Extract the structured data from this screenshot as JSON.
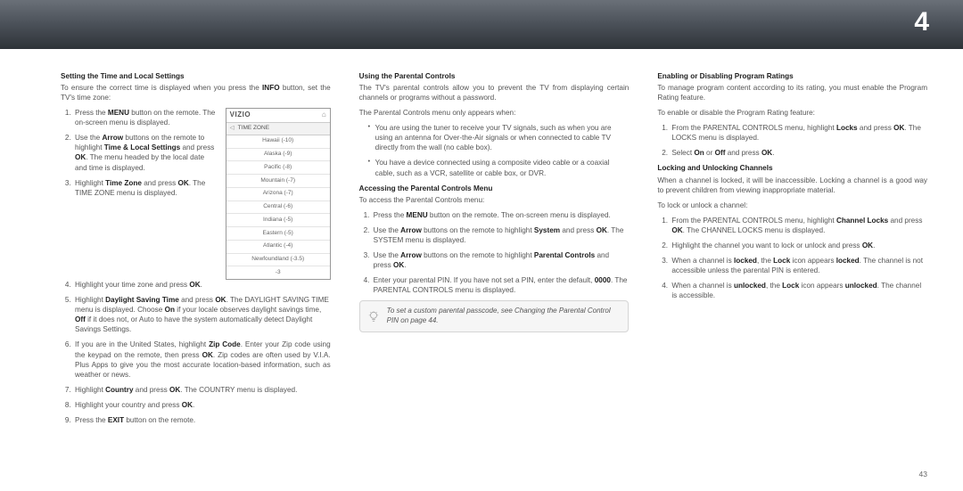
{
  "chapter": "4",
  "page_number": "43",
  "col1": {
    "h1": "Setting the Time and Local Settings",
    "p1a": "To ensure the correct time is displayed when you press the ",
    "p1b": "INFO",
    "p1c": " button, set the TV's time zone:",
    "li1a": "Press the ",
    "li1b": "MENU",
    "li1c": " button on the remote. The on-screen menu is displayed.",
    "li2a": "Use the ",
    "li2b": "Arrow",
    "li2c": " buttons on the remote to highlight ",
    "li2d": "Time & Local Settings",
    "li2e": " and press ",
    "li2f": "OK",
    "li2g": ". The menu headed by the local date and time is displayed.",
    "li3a": "Highlight ",
    "li3b": "Time Zone",
    "li3c": " and press ",
    "li3d": "OK",
    "li3e": ". The TIME ZONE menu is displayed.",
    "li4a": "Highlight your time zone and press ",
    "li4b": "OK",
    "li4c": ".",
    "li5a": "Highlight ",
    "li5b": "Daylight Saving Time",
    "li5c": " and press ",
    "li5d": "OK",
    "li5e": ". The DAYLIGHT SAVING TIME menu is displayed. Choose ",
    "li5f": "On",
    "li5g": " if your locale observes daylight savings time, ",
    "li5h": "Off",
    "li5i": " if it does not, or Auto to have the system automatically detect Daylight Savings Settings.",
    "li6a": "If you are in the United States, highlight ",
    "li6b": "Zip Code",
    "li6c": ". Enter your Zip code using the keypad on the remote, then press ",
    "li6d": "OK",
    "li6e": ". Zip codes are often used by V.I.A. Plus Apps to give you the most accurate location-based information, such as weather or news.",
    "li7a": "Highlight ",
    "li7b": "Country",
    "li7c": " and press ",
    "li7d": "OK",
    "li7e": ". The COUNTRY menu is displayed.",
    "li8a": "Highlight your country and press ",
    "li8b": "OK",
    "li8c": ".",
    "li9a": "Press the ",
    "li9b": "EXIT",
    "li9c": " button on the remote."
  },
  "menu": {
    "brand": "VIZIO",
    "title": "TIME ZONE",
    "rows": [
      "Hawaii (-10)",
      "Alaska (-9)",
      "Pacific (-8)",
      "Mountain (-7)",
      "Arizona (-7)",
      "Central (-6)",
      "Indiana (-5)",
      "Eastern (-5)",
      "Atlantic (-4)",
      "Newfoundland (-3.5)",
      "-3"
    ]
  },
  "col2": {
    "h1": "Using the Parental Controls",
    "p1": "The TV's parental controls allow you to prevent the TV from displaying certain channels or programs without a password.",
    "p2": "The Parental Controls menu only appears when:",
    "b1": "You are using the tuner to receive your TV signals, such as when you are using an antenna for Over-the-Air signals or when connected to cable TV directly from the wall (no cable box).",
    "b2": "You have a device connected using a composite video cable or a coaxial cable, such as a VCR, satellite or cable box, or DVR.",
    "h2": "Accessing the Parental Controls Menu",
    "p3": "To access the Parental Controls menu:",
    "li1a": "Press the ",
    "li1b": "MENU",
    "li1c": " button on the remote. The on-screen menu is displayed.",
    "li2a": "Use the ",
    "li2b": "Arrow",
    "li2c": " buttons on the remote to highlight ",
    "li2d": "System",
    "li2e": " and press ",
    "li2f": "OK",
    "li2g": ". The SYSTEM menu is displayed.",
    "li3a": "Use the ",
    "li3b": "Arrow",
    "li3c": " buttons on the remote to highlight ",
    "li3d": "Parental Controls",
    "li3e": " and press ",
    "li3f": "OK",
    "li3g": ".",
    "li4a": "Enter your parental PIN. If you have not set a PIN, enter the default, ",
    "li4b": "0000",
    "li4c": ". The PARENTAL CONTROLS menu is displayed.",
    "callout_a": "To set a custom parental passcode, see ",
    "callout_b": "Changing the Parental Control PIN",
    "callout_c": " on page 44."
  },
  "col3": {
    "h1": "Enabling or Disabling Program Ratings",
    "p1": "To manage program content according to its rating, you must enable the Program Rating feature.",
    "p2": "To enable or disable the Program Rating feature:",
    "li1a": "From the PARENTAL CONTROLS menu, highlight ",
    "li1b": "Locks",
    "li1c": " and press ",
    "li1d": "OK",
    "li1e": ". The LOCKS menu is displayed.",
    "li2a": "Select ",
    "li2b": "On",
    "li2c": " or ",
    "li2d": "Off",
    "li2e": " and press ",
    "li2f": "OK",
    "li2g": ".",
    "h2": "Locking and Unlocking Channels",
    "p3": "When a channel is locked, it will be inaccessible. Locking a channel is a good way to prevent children from viewing inappropriate material.",
    "p4": "To lock or unlock a channel:",
    "bli1a": "From the PARENTAL CONTROLS menu, highlight ",
    "bli1b": "Channel Locks",
    "bli1c": " and press ",
    "bli1d": "OK",
    "bli1e": ". The CHANNEL LOCKS menu is displayed.",
    "bli2a": "Highlight the channel you want to lock or unlock and press ",
    "bli2b": "OK",
    "bli2c": ".",
    "bli3a": "When a channel is ",
    "bli3b": "locked",
    "bli3c": ", the ",
    "bli3d": "Lock",
    "bli3e": " icon appears ",
    "bli3f": "locked",
    "bli3g": ". The channel is not accessible unless the parental PIN is entered.",
    "bli4a": "When a channel is ",
    "bli4b": "unlocked",
    "bli4c": ", the ",
    "bli4d": "Lock",
    "bli4e": " icon appears ",
    "bli4f": "unlocked",
    "bli4g": ". The channel is accessible."
  }
}
